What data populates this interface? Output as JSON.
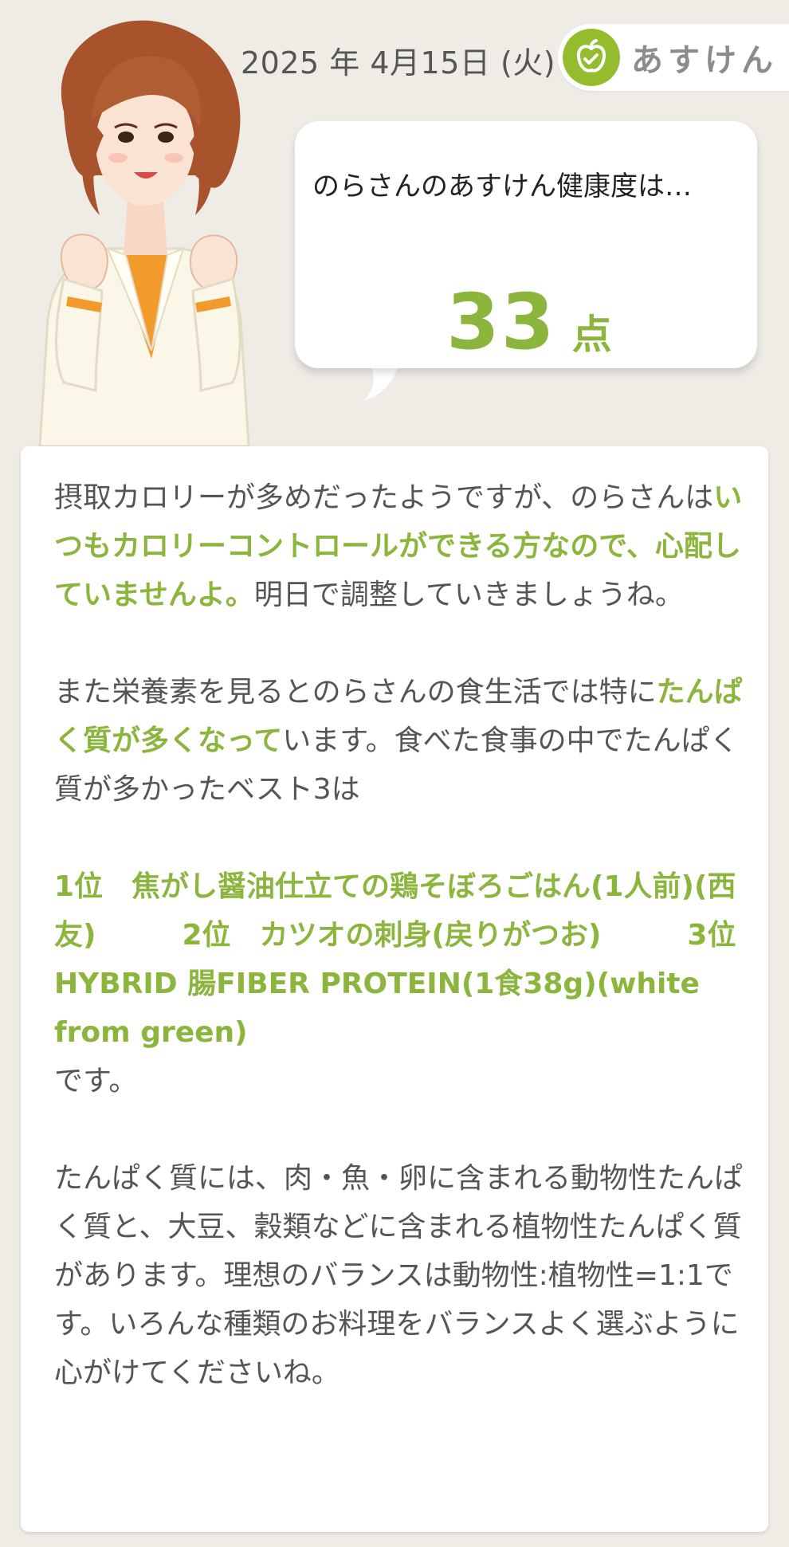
{
  "header": {
    "date": "2025 年 4月15日 (火)",
    "logo_text": "あすけん"
  },
  "bubble": {
    "lead": "のらさんのあすけん健康度は…",
    "score": "33",
    "score_unit": "点"
  },
  "message": {
    "p1": [
      "摂取カロリーが多めだったようですが、のらさんは",
      "いつもカロリーコントロールができる方なので、心配していませんよ。",
      "明日で調整していきましょうね。"
    ],
    "p2": [
      "また栄養素を見るとのらさんの食生活では特に",
      "たんぱく質が多くなって",
      "います。食べた食事の中でたんぱく質が多かったベスト3は"
    ],
    "p3": [
      "1位　焦がし醤油仕立ての鶏そぼろごはん(1人前)(西友)　　　2位　カツオの刺身(戻りがつお)　　　3位　HYBRID 腸FIBER PROTEIN(1食38g)(white from green)",
      "です。"
    ],
    "p4": "たんぱく質には、肉・魚・卵に含まれる動物性たんぱく質と、大豆、穀類などに含まれる植物性たんぱく質があります。理想のバランスは動物性:植物性=1:1です。いろんな種類のお料理をバランスよく選ぶように心がけてくださいね。"
  },
  "colors": {
    "background": "#efece6",
    "accent_green": "#8bb53c",
    "logo_green": "#93bd2e",
    "text_gray": "#555555"
  }
}
